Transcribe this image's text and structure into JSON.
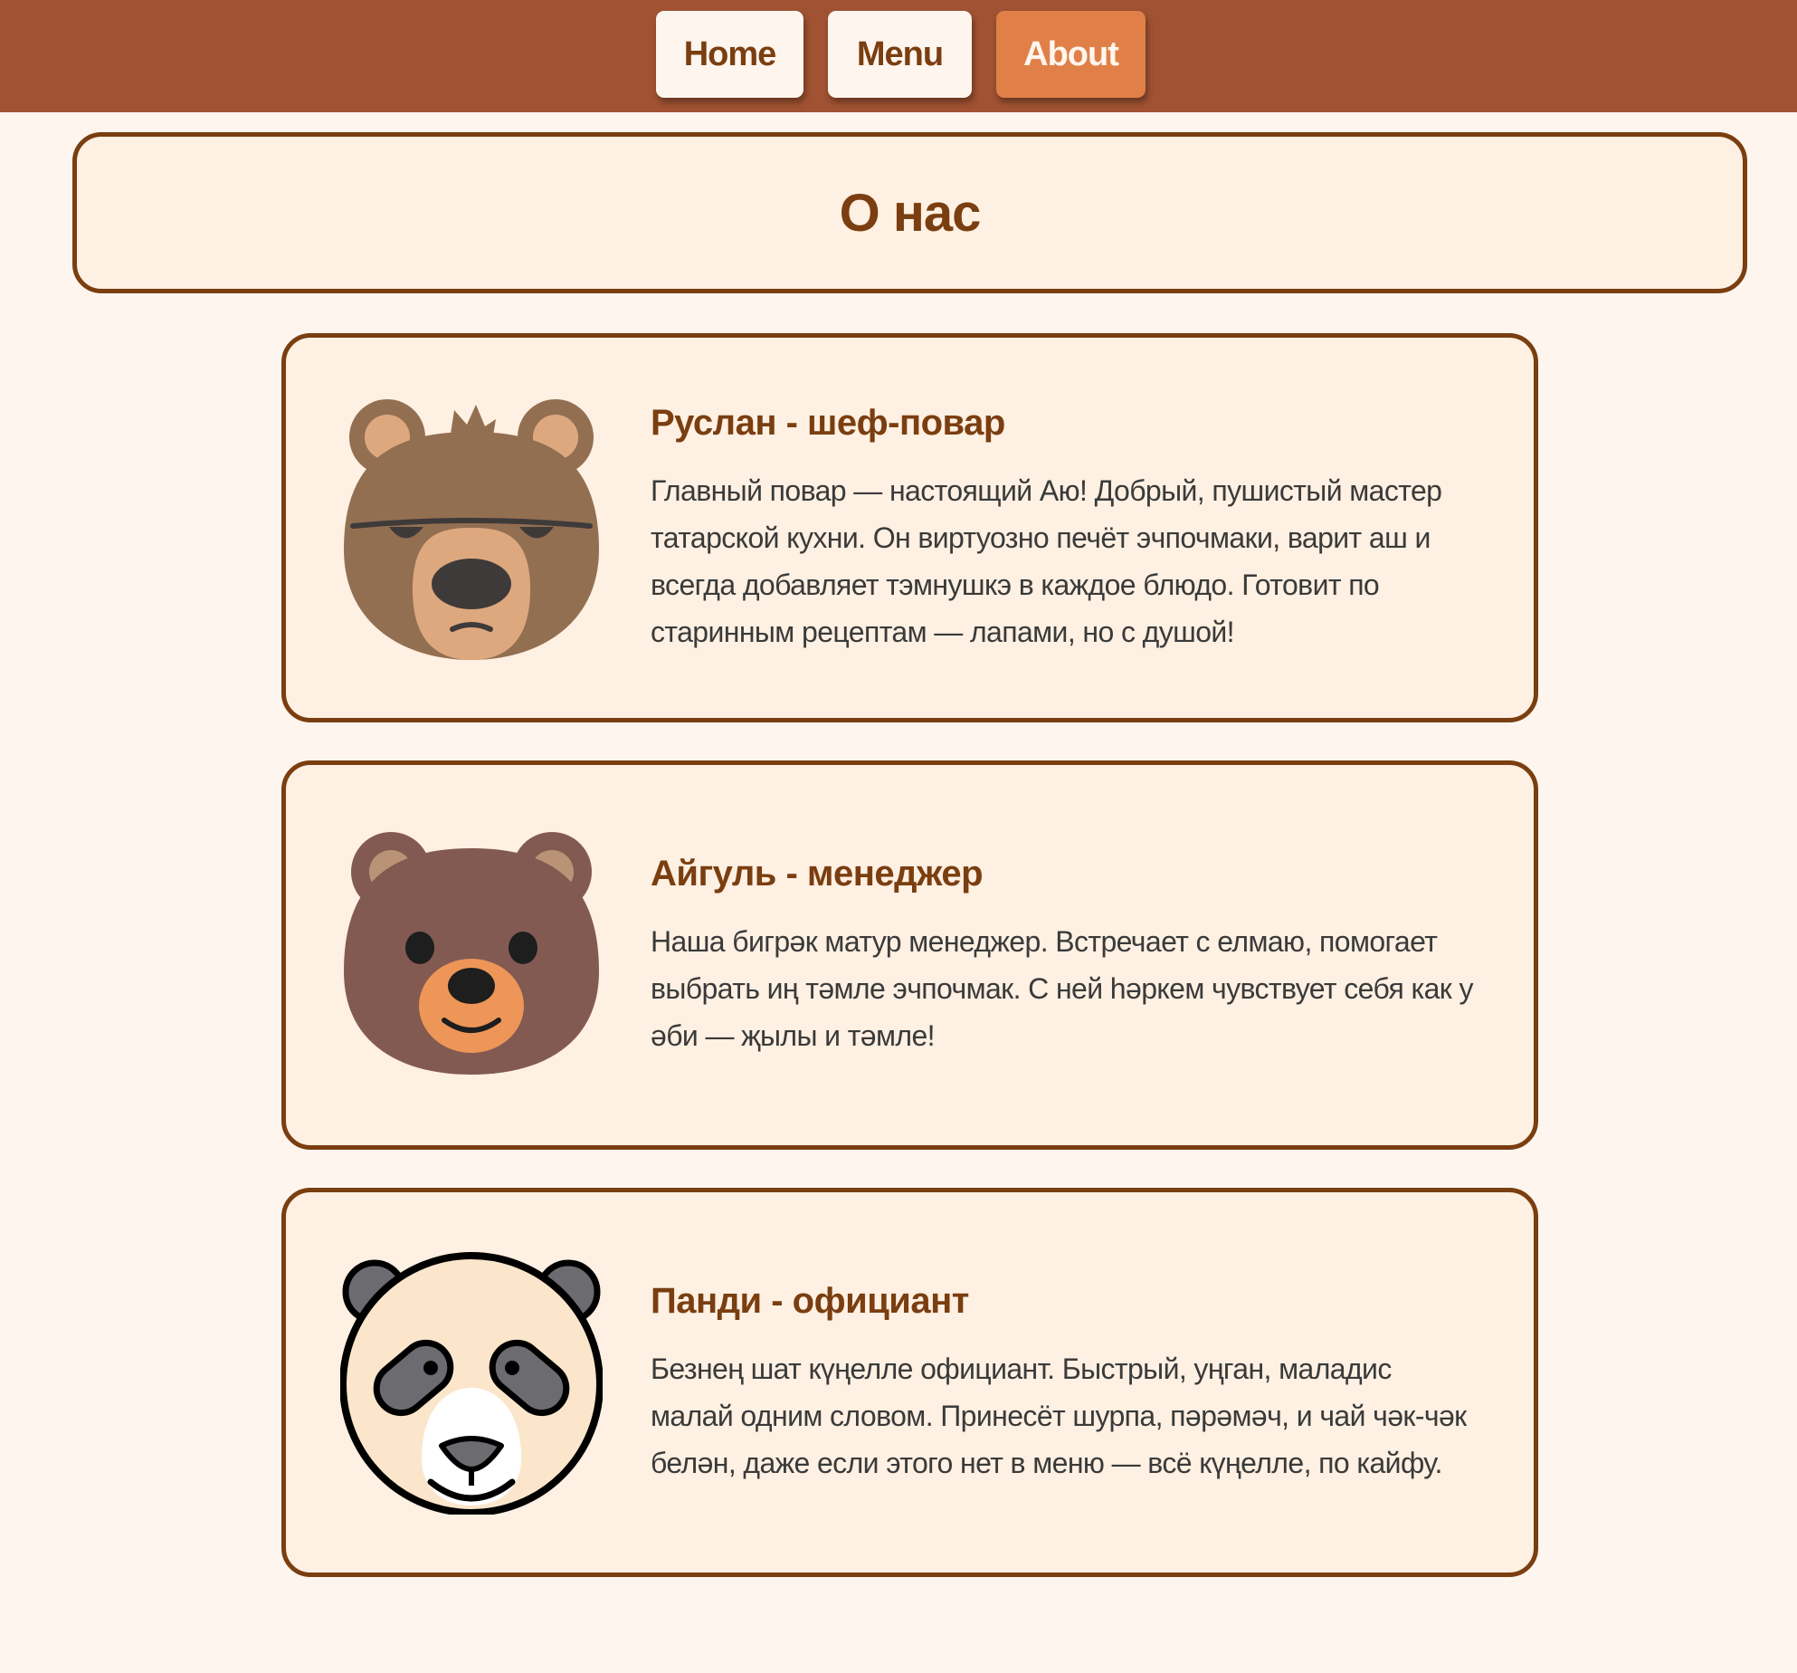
{
  "nav": {
    "items": [
      {
        "label": "Home",
        "active": false
      },
      {
        "label": "Menu",
        "active": false
      },
      {
        "label": "About",
        "active": true
      }
    ]
  },
  "page": {
    "title": "О нас"
  },
  "colors": {
    "navbar": "#a05232",
    "accent": "#e08048",
    "brown_text": "#7a3e10",
    "card_bg": "#fef0e2",
    "page_bg": "#fdf5ee"
  },
  "team": [
    {
      "name": "Руслан - шеф-повар",
      "description": "Главный повар — настоящий Аю! Добрый, пушистый мастер татарской кухни. Он виртуозно печёт эчпочмаки, варит аш и всегда добавляет тэмнушкэ в каждое блюдо. Готовит по старинным рецептам — лапами, но с душой!",
      "icon": "grumpy-bear-icon"
    },
    {
      "name": "Айгуль - менеджер",
      "description": "Наша бигрәк матур менеджер. Встречает с елмаю, помогает выбрать иң тәмле эчпочмак. С ней һәркем чувствует себя как у әби — җылы и тәмле!",
      "icon": "smiling-bear-icon"
    },
    {
      "name": "Панди - официант",
      "description": "Безнең шат күңелле официант. Быстрый, уңган, маладис малай одним словом. Принесёт шурпа, пәрәмәч, и чай чәк-чәк белән, даже если этого нет в меню — всё күңелле, по кайфу.",
      "icon": "panda-icon"
    }
  ]
}
